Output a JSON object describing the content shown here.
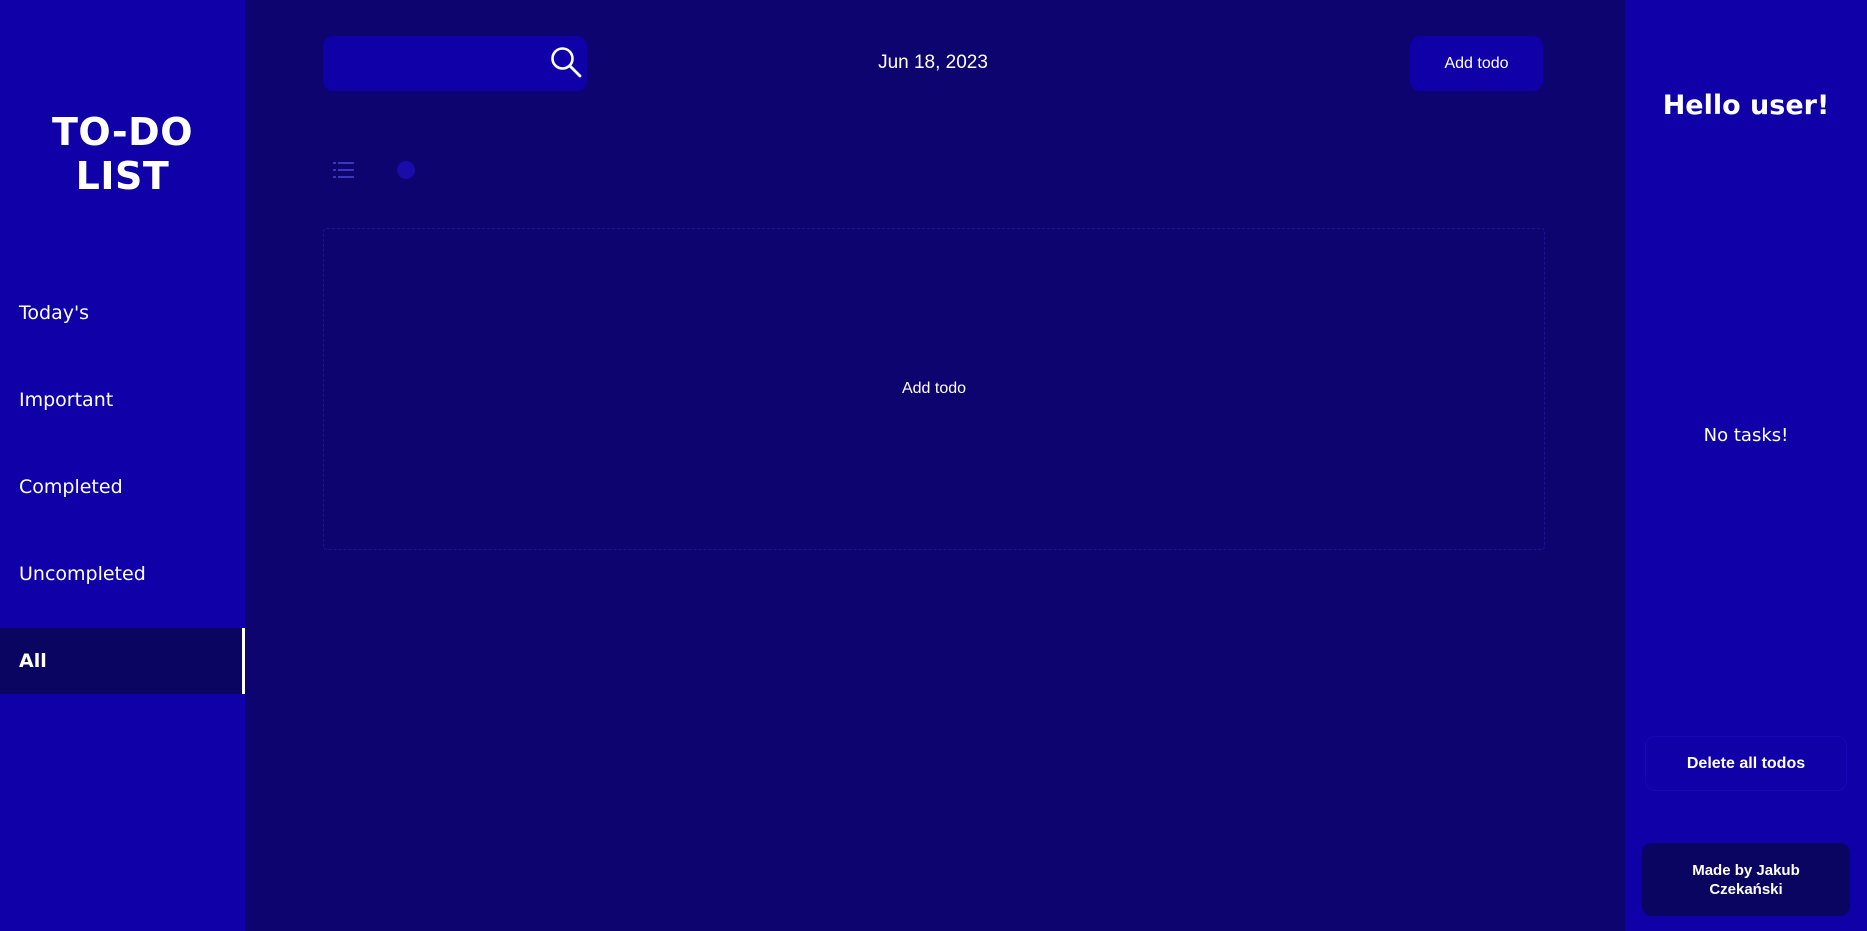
{
  "app": {
    "title": "TO-DO LIST"
  },
  "sidebar": {
    "items": [
      {
        "label": "Today's"
      },
      {
        "label": "Important"
      },
      {
        "label": "Completed"
      },
      {
        "label": "Uncompleted"
      },
      {
        "label": "All",
        "active": true
      }
    ]
  },
  "header": {
    "search": {
      "value": "",
      "placeholder": "",
      "icon": "search-icon"
    },
    "date": "Jun 18, 2023",
    "add_button": "Add todo"
  },
  "view_toggle": {
    "list_icon": "list-view-icon",
    "grid_icon": "grid-view-icon"
  },
  "main": {
    "add_area_label": "Add todo"
  },
  "right_panel": {
    "greeting": "Hello user!",
    "empty_message": "No tasks!",
    "delete_button": "Delete all todos",
    "credit": "Made by Jakub Czekański"
  },
  "colors": {
    "sidebar_bg": "#0f00a8",
    "main_bg": "#0d0470",
    "active_item_bg": "#0a0560",
    "text": "#ffffff"
  }
}
